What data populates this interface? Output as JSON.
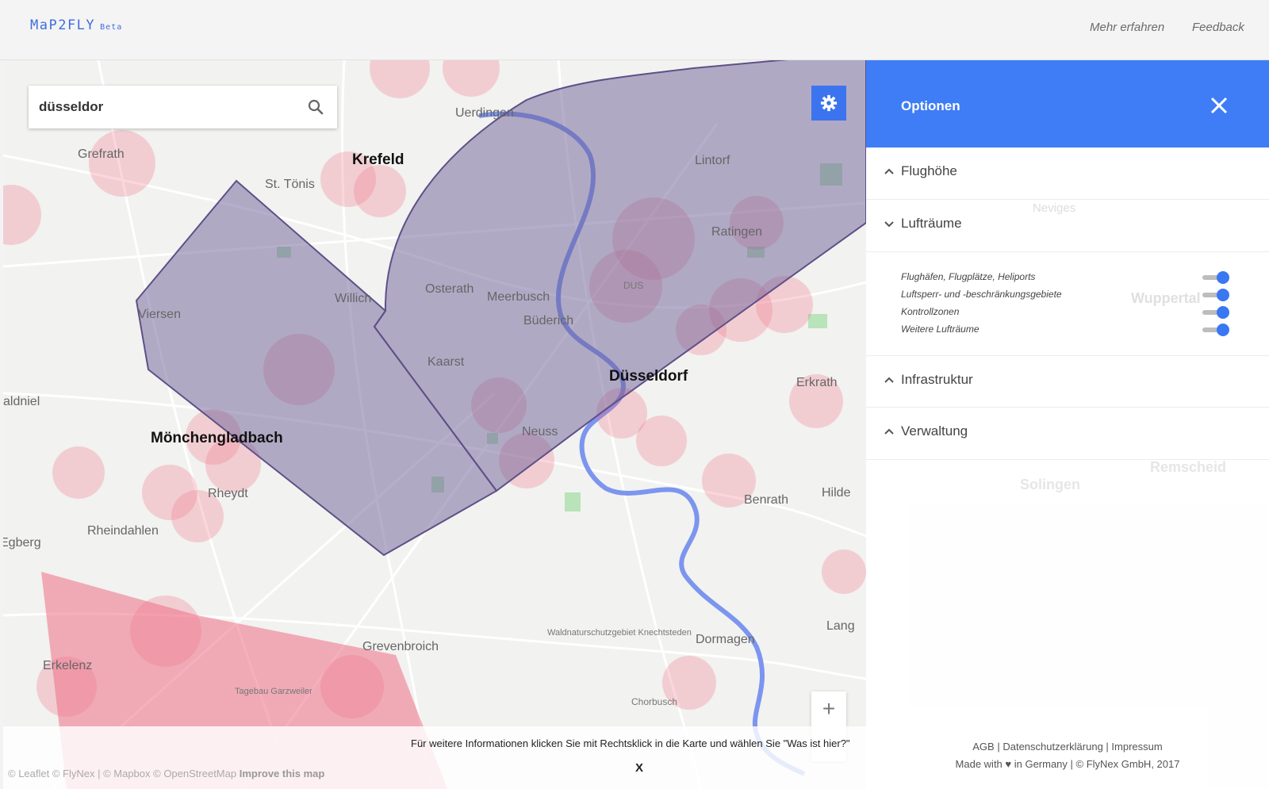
{
  "header": {
    "logo": "MaP2FLY",
    "logo_badge": "Beta",
    "nav": {
      "learn_more": "Mehr erfahren",
      "feedback": "Feedback"
    }
  },
  "search": {
    "value": "düsseldor",
    "icon": "search-icon"
  },
  "settings_button": {
    "icon": "gear-icon"
  },
  "map": {
    "cities": [
      "Krefeld",
      "Düsseldorf",
      "Mönchengladbach"
    ],
    "places": [
      "Uerdingen",
      "Grefrath",
      "St. Tönis",
      "Lintorf",
      "Ratingen",
      "Osterath",
      "Willich",
      "Meerbusch",
      "Viersen",
      "Büderich",
      "Kaarst",
      "Erkrath",
      "Neuss",
      "Rheydt",
      "Rheindahlen",
      "Benrath",
      "Hilde",
      "Dormagen",
      "Grevenbroich",
      "Erkelenz",
      "Egberg",
      "aldniel",
      "Lang",
      "Neviges",
      "Wuppertal",
      "Solingen",
      "Remscheid"
    ],
    "small_labels": {
      "dus": "DUS",
      "forest": "Waldnaturschutzgebiet Knechtsteden",
      "mine": "Tagebau Garzweiler",
      "chorbusch": "Chorbusch"
    },
    "zoom_in_label": "+",
    "colors": {
      "airspace": "#6d5f97",
      "restricted": "#ef6f86",
      "water": "#7c95ef",
      "accent": "#3f7df6"
    }
  },
  "info_bar": {
    "text": "Für weitere Informationen klicken Sie mit Rechtsklick in die Karte und wählen Sie \"Was ist hier?\"",
    "close_label": "X"
  },
  "attribution": {
    "text": "© Leaflet © FlyNex | © Mapbox © OpenStreetMap",
    "improve": "Improve this map"
  },
  "panel": {
    "title": "Optionen",
    "close_icon": "close-icon",
    "sections": [
      {
        "label": "Flughöhe",
        "expanded": false
      },
      {
        "label": "Lufträume",
        "expanded": true
      },
      {
        "label": "Infrastruktur",
        "expanded": false
      },
      {
        "label": "Verwaltung",
        "expanded": false
      }
    ],
    "airspace_toggles": [
      {
        "label": "Flughäfen, Flugplätze, Heliports",
        "on": true
      },
      {
        "label": "Luftsperr- und -beschränkungsgebiete",
        "on": true
      },
      {
        "label": "Kontrollzonen",
        "on": true
      },
      {
        "label": "Weitere Lufträume",
        "on": true
      }
    ],
    "footer": {
      "agb": "AGB",
      "privacy": "Datenschutzerklärung",
      "imprint": "Impressum",
      "made_with": "Made with ♥ in Germany | © FlyNex GmbH, 2017"
    }
  }
}
